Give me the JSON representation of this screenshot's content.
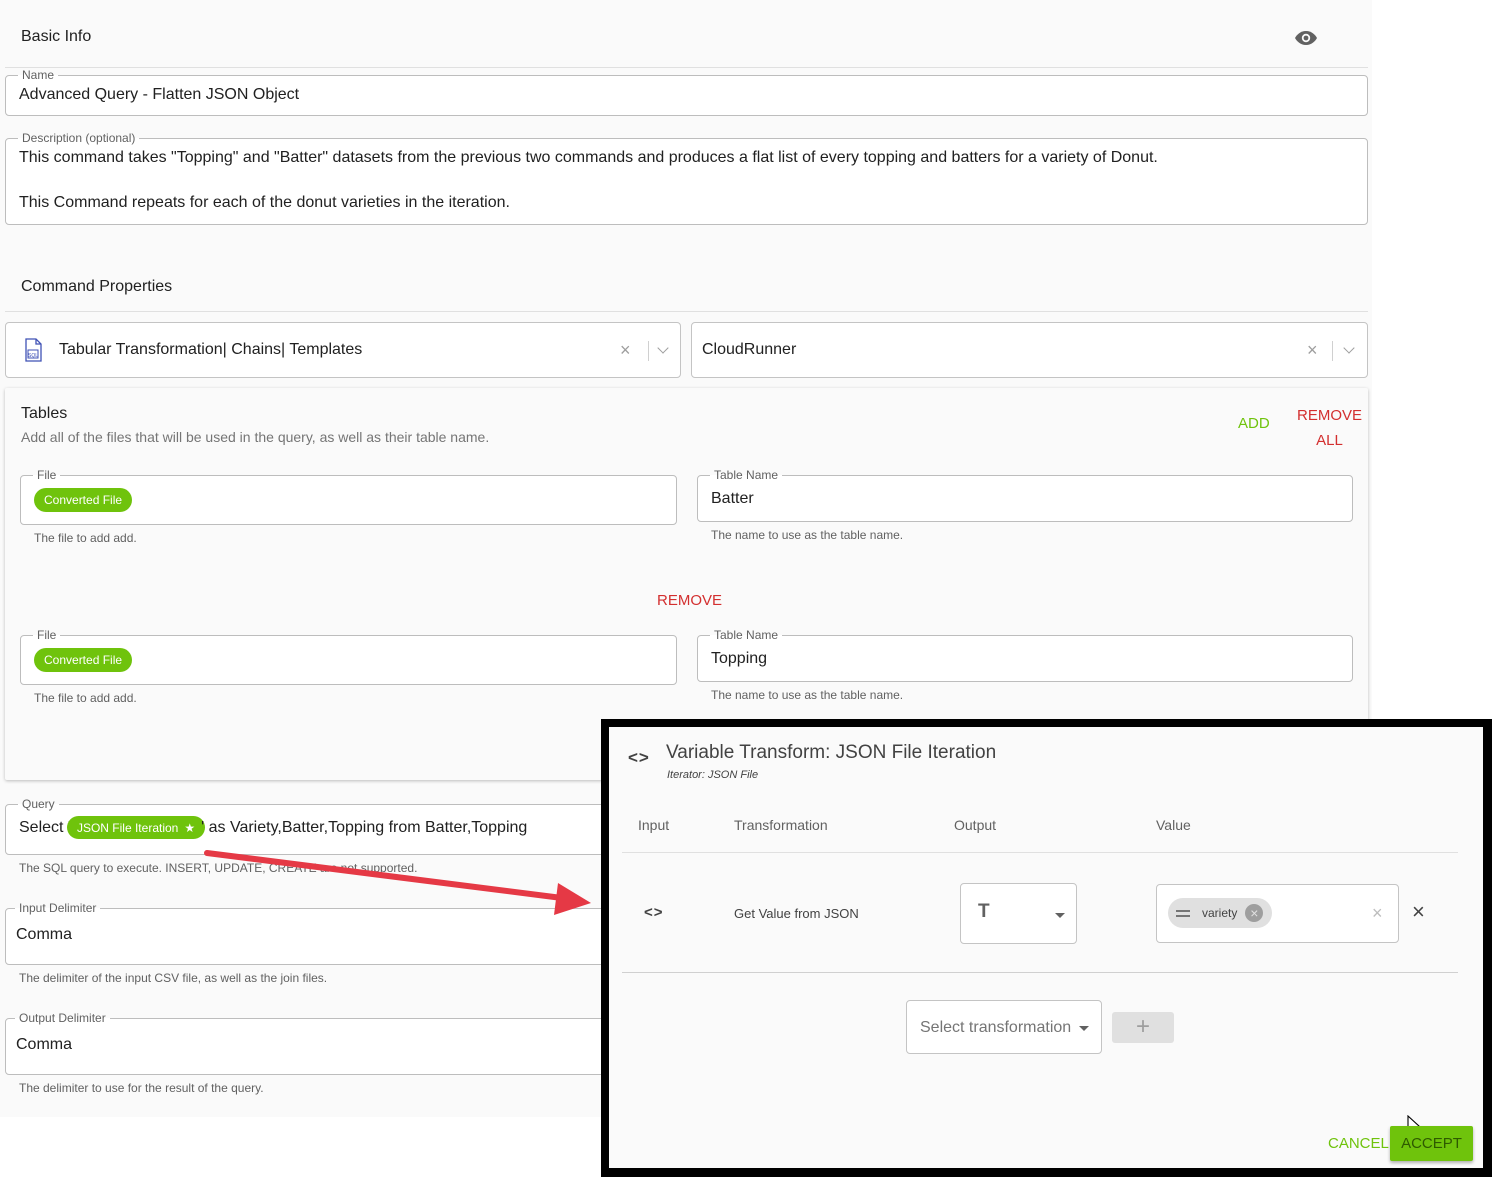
{
  "basic_info": {
    "title": "Basic Info",
    "eye_icon": "eye-icon"
  },
  "name_field": {
    "label": "Name",
    "value": "Advanced Query - Flatten JSON Object"
  },
  "description_field": {
    "label": "Description (optional)",
    "line1": "This command takes \"Topping\" and \"Batter\" datasets from the previous two commands and produces a flat list of every topping and batters for a variety of Donut.",
    "line2": "This Command repeats for each of the donut varieties in the iteration."
  },
  "command_properties": {
    "title": "Command Properties",
    "command_select": {
      "value": "Tabular Transformation| Chains| Templates",
      "icon": "sql-file-icon"
    },
    "runner_select": {
      "value": "CloudRunner"
    }
  },
  "tables": {
    "title": "Tables",
    "subtitle": "Add all of the files that will be used in the query, as well as their table name.",
    "add_label": "ADD",
    "remove_all_line1": "REMOVE",
    "remove_all_line2": "ALL",
    "remove_label": "REMOVE",
    "rows": [
      {
        "file_label": "File",
        "file_chip": "Converted File",
        "file_helper": "The file to add add.",
        "table_label": "Table Name",
        "table_value": "Batter",
        "table_helper": "The name to use as the table name."
      },
      {
        "file_label": "File",
        "file_chip": "Converted File",
        "file_helper": "The file to add add.",
        "table_label": "Table Name",
        "table_value": "Topping",
        "table_helper": "The name to use as the table name."
      }
    ]
  },
  "query": {
    "label": "Query",
    "prefix": "Select '",
    "chip": "JSON File Iteration",
    "suffix": "' as Variety,Batter,Topping from Batter,Topping",
    "helper": "The SQL query to execute. INSERT, UPDATE, CREATE are not supported."
  },
  "input_delimiter": {
    "label": "Input Delimiter",
    "value": "Comma",
    "helper": "The delimiter of the input CSV file, as well as the join files."
  },
  "output_delimiter": {
    "label": "Output Delimiter",
    "value": "Comma",
    "helper": "The delimiter to use for the result of the query."
  },
  "dialog": {
    "title": "Variable Transform: JSON File Iteration",
    "subtitle": "Iterator: JSON File",
    "columns": {
      "input": "Input",
      "transformation": "Transformation",
      "output": "Output",
      "value": "Value"
    },
    "row": {
      "transformation": "Get Value from JSON",
      "output_type": "T",
      "value_chip": "variety"
    },
    "select_placeholder": "Select transformation",
    "add_symbol": "+",
    "cancel_label": "CANCEL",
    "accept_label": "ACCEPT"
  },
  "colors": {
    "accent_green": "#6fc30c",
    "danger_red": "#d32f2f",
    "arrow_red": "#e53945"
  }
}
